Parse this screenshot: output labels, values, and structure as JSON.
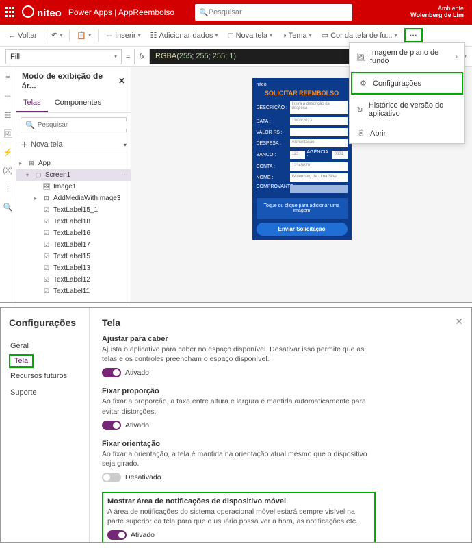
{
  "header": {
    "logo": "niteo",
    "app_title": "Power Apps | AppReembolso",
    "search_placeholder": "Pesquisar",
    "env_label": "Ambiente",
    "env_name": "Wolenberg de Lim"
  },
  "cmd": {
    "back": "Voltar",
    "insert": "Inserir",
    "add_data": "Adicionar dados",
    "new_screen": "Nova tela",
    "theme": "Tema",
    "bg_color": "Cor da tela de fu..."
  },
  "fx": {
    "prop": "Fill",
    "code_fn": "RGBA",
    "code_args": "(255; 255; 255; 1)"
  },
  "overflow": {
    "bg_image": "Imagem de plano de fundo",
    "settings": "Configurações",
    "version": "Histórico de versão do aplicativo",
    "open": "Abrir"
  },
  "tree": {
    "title": "Modo de exibição de ár...",
    "tab_screens": "Telas",
    "tab_components": "Componentes",
    "search_placeholder": "Pesquisar",
    "new_screen": "Nova tela",
    "nodes": {
      "app": "App",
      "screen1": "Screen1",
      "image1": "Image1",
      "addmedia": "AddMediaWithImage3",
      "l15_1": "TextLabel15_1",
      "l18": "TextLabel18",
      "l16": "TextLabel16",
      "l17": "TextLabel17",
      "l15": "TextLabel15",
      "l13": "TextLabel13",
      "l12": "TextLabel12",
      "l11": "TextLabel11"
    }
  },
  "phone": {
    "brand": "niteo",
    "title": "SOLICITAR REEMBOLSO",
    "desc_label": "DESCRIÇÃO :",
    "desc_ph": "Insira a descrição da despesa",
    "date_label": "DATA :",
    "date_val": "11/08/2023",
    "valor_label": "VALOR R$ :",
    "despesa_label": "DESPESA :",
    "despesa_val": "Alimentação",
    "banco_label": "BANCO :",
    "banco_val": "123",
    "agencia_label": "AGÊNCIA :",
    "agencia_val": "0001",
    "conta_label": "CONTA :",
    "conta_val": "12345678",
    "nome_label": "NOME :",
    "nome_val": "Wolenberg de Lima Silva",
    "comp_label": "COMPROVANTE :",
    "upload": "Toque ou clique para adicionar uma imagem",
    "submit": "Enviar Solicitação"
  },
  "settings": {
    "title": "Configurações",
    "nav": {
      "geral": "Geral",
      "tela": "Tela",
      "futuros": "Recursos futuros",
      "suporte": "Suporte"
    },
    "page_title": "Tela",
    "opt1": {
      "label": "Ajustar para caber",
      "desc": "Ajusta o aplicativo para caber no espaço disponível. Desativar isso permite que as telas e os controles preencham o espaço disponível.",
      "state": "Ativado"
    },
    "opt2": {
      "label": "Fixar proporção",
      "desc": "Ao fixar a proporção, a taxa entre altura e largura é mantida automaticamente para evitar distorções.",
      "state": "Ativado"
    },
    "opt3": {
      "label": "Fixar orientação",
      "desc": "Ao fixar a orientação, a tela é mantida na orientação atual mesmo que o dispositivo seja girado.",
      "state": "Desativado"
    },
    "opt4": {
      "label": "Mostrar área de notificações de dispositivo móvel",
      "desc": "A área de notificações do sistema operacional móvel estará sempre visível na parte superior da tela para que o usuário possa ver a hora, as notificações etc.",
      "state": "Ativado"
    }
  }
}
